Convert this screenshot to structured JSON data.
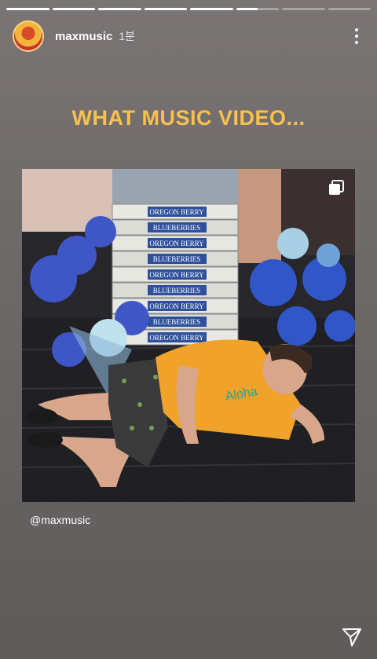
{
  "story": {
    "segments": [
      {
        "progress": 1
      },
      {
        "progress": 1
      },
      {
        "progress": 1
      },
      {
        "progress": 1
      },
      {
        "progress": 1
      },
      {
        "progress": 0.5
      },
      {
        "progress": 0
      },
      {
        "progress": 0
      }
    ]
  },
  "header": {
    "username": "maxmusic",
    "time": "1분"
  },
  "post": {
    "headline": "WHAT MUSIC VIDEO...",
    "box_brand": "OREGON BERRY",
    "box_sub": "BLUEBERRIES",
    "mention": "@maxmusic"
  },
  "icons": {
    "avatar": "profile-avatar",
    "more": "more-vertical-icon",
    "multi": "multiple-photos-icon",
    "send": "send-icon"
  }
}
